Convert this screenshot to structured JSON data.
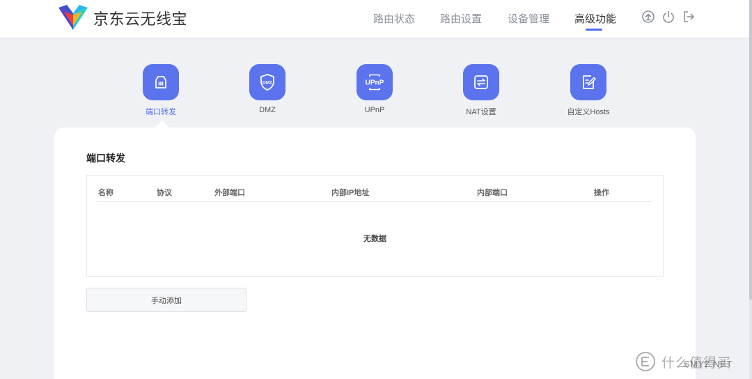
{
  "header": {
    "brand": "京东云无线宝",
    "nav": [
      {
        "label": "路由状态"
      },
      {
        "label": "路由设置"
      },
      {
        "label": "设备管理"
      },
      {
        "label": "高级功能",
        "active": true
      }
    ],
    "icons": [
      "upgrade-icon",
      "power-icon",
      "logout-icon"
    ]
  },
  "features": [
    {
      "label": "端口转发",
      "icon": "port-forward-icon",
      "active": true
    },
    {
      "label": "DMZ",
      "icon": "dmz-shield-icon",
      "icon_text": "DMZ"
    },
    {
      "label": "UPnP",
      "icon": "upnp-icon",
      "icon_text": "UPnP"
    },
    {
      "label": "NAT设置",
      "icon": "nat-arrows-icon"
    },
    {
      "label": "自定义Hosts",
      "icon": "edit-hosts-icon"
    }
  ],
  "section": {
    "title": "端口转发",
    "columns": [
      "名称",
      "协议",
      "外部端口",
      "内部IP地址",
      "内部端口",
      "操作"
    ],
    "rows": [],
    "empty_text": "无数据",
    "add_button": "手动添加"
  },
  "watermark": {
    "text": "什么值得买",
    "url": "SMYZ.NET"
  },
  "colors": {
    "accent": "#4e6ef2",
    "tile": "#5b74ee",
    "background": "#eff1f5"
  }
}
